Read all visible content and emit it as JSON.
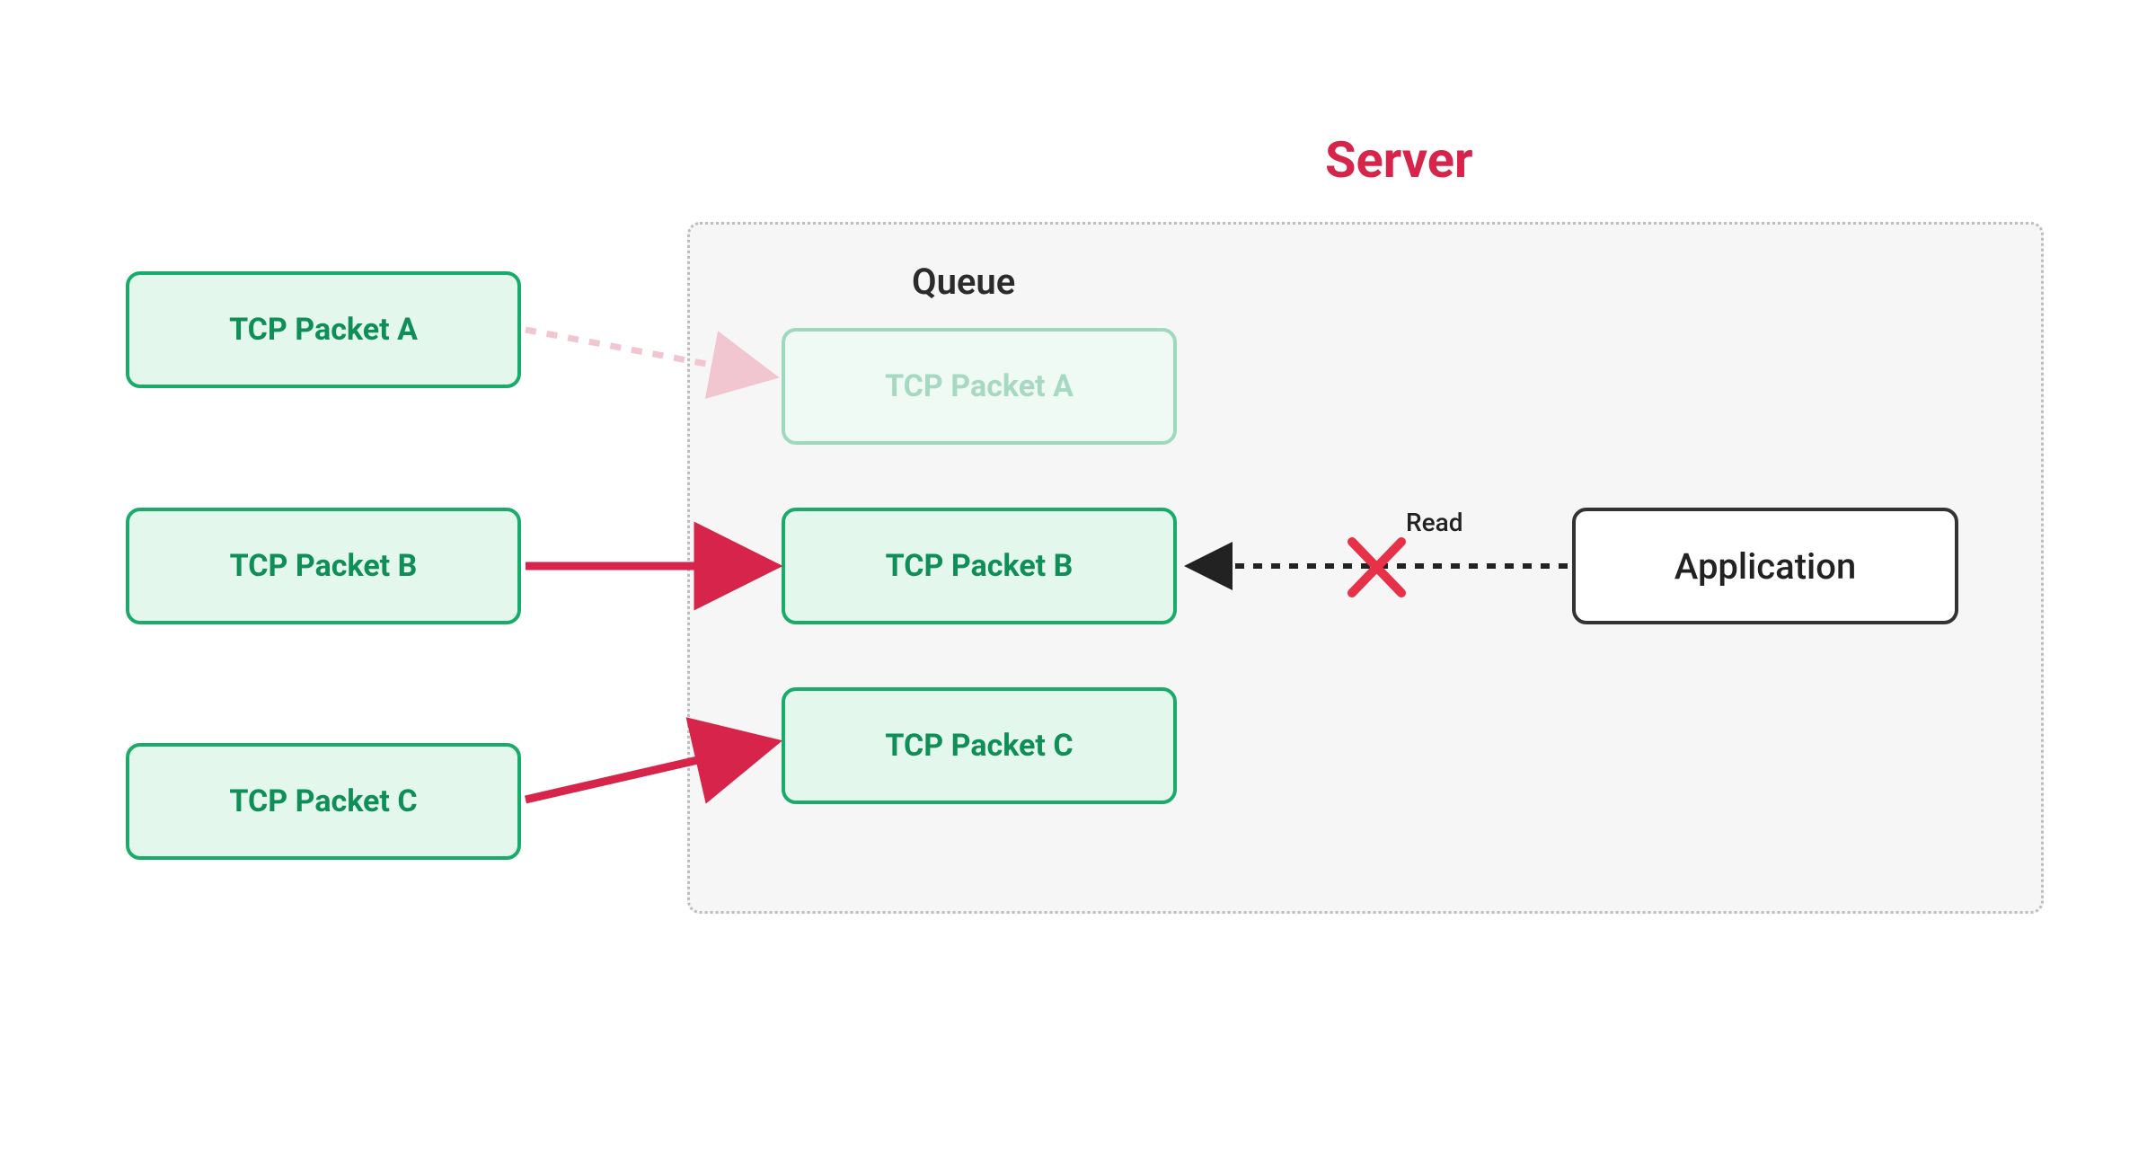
{
  "title": "Server",
  "queue_label": "Queue",
  "read_label": "Read",
  "application_label": "Application",
  "left_packets": {
    "a": "TCP Packet A",
    "b": "TCP Packet B",
    "c": "TCP Packet C"
  },
  "queue_packets": {
    "a": "TCP Packet A",
    "b": "TCP Packet B",
    "c": "TCP Packet C"
  },
  "colors": {
    "accent_red": "#d6244a",
    "accent_red_faded": "#f2c6d0",
    "green_border": "#1aab6b",
    "green_fill": "#e3f7ec",
    "green_text": "#0f8f57",
    "panel_bg": "#f6f6f6",
    "panel_border": "#bdbdbd",
    "black": "#222222"
  },
  "chart_data": {
    "type": "diagram",
    "description": "TCP packet queue at server with head-of-line blocking",
    "nodes": [
      {
        "id": "src_a",
        "label": "TCP Packet A",
        "group": "source"
      },
      {
        "id": "src_b",
        "label": "TCP Packet B",
        "group": "source"
      },
      {
        "id": "src_c",
        "label": "TCP Packet C",
        "group": "source"
      },
      {
        "id": "q_a",
        "label": "TCP Packet A",
        "group": "queue",
        "state": "missing"
      },
      {
        "id": "q_b",
        "label": "TCP Packet B",
        "group": "queue",
        "state": "present"
      },
      {
        "id": "q_c",
        "label": "TCP Packet C",
        "group": "queue",
        "state": "present"
      },
      {
        "id": "app",
        "label": "Application",
        "group": "consumer"
      }
    ],
    "edges": [
      {
        "from": "src_a",
        "to": "q_a",
        "style": "dotted",
        "state": "lost"
      },
      {
        "from": "src_b",
        "to": "q_b",
        "style": "solid",
        "state": "ok"
      },
      {
        "from": "src_c",
        "to": "q_c",
        "style": "solid",
        "state": "ok"
      },
      {
        "from": "app",
        "to": "q_b",
        "style": "dotted",
        "label": "Read",
        "state": "blocked"
      }
    ],
    "containers": [
      {
        "id": "server",
        "label": "Server",
        "contains": [
          "q_a",
          "q_b",
          "q_c",
          "app"
        ]
      },
      {
        "id": "queue",
        "label": "Queue",
        "contains": [
          "q_a",
          "q_b",
          "q_c"
        ]
      }
    ]
  }
}
